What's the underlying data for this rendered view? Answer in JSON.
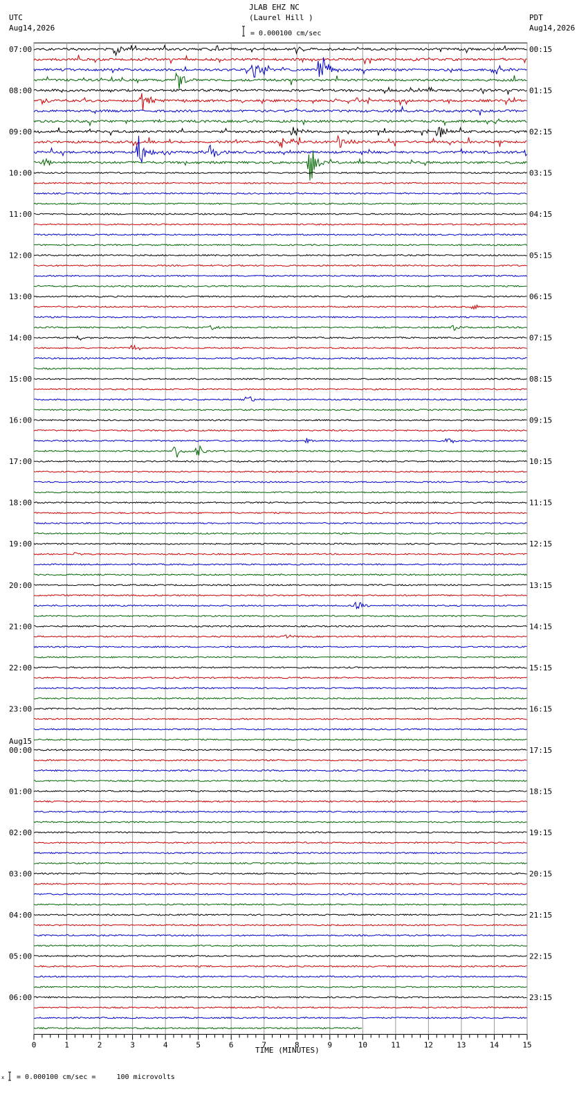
{
  "header": {
    "station": "JLAB EHZ NC",
    "location": "(Laurel Hill )",
    "scale_text": "= 0.000100 cm/sec",
    "left_tz": "UTC",
    "left_date": "Aug14,2026",
    "right_tz": "PDT",
    "right_date": "Aug14,2026"
  },
  "footer": {
    "scale_prefix": "x",
    "scale_text": "= 0.000100 cm/sec =     100 microvolts"
  },
  "chart_data": {
    "type": "line",
    "title": "JLAB EHZ NC (Laurel Hill )",
    "xlabel": "TIME (MINUTES)",
    "xlim": [
      0,
      15
    ],
    "x_ticks": [
      0,
      1,
      2,
      3,
      4,
      5,
      6,
      7,
      8,
      9,
      10,
      11,
      12,
      13,
      14,
      15
    ],
    "trace_colors": [
      "#000000",
      "#cc0000",
      "#0000cc",
      "#006600"
    ],
    "traces_per_hour": 4,
    "left_labels": [
      "07:00",
      "08:00",
      "09:00",
      "10:00",
      "11:00",
      "12:00",
      "13:00",
      "14:00",
      "15:00",
      "16:00",
      "17:00",
      "18:00",
      "19:00",
      "20:00",
      "21:00",
      "22:00",
      "23:00",
      "00:00",
      "01:00",
      "02:00",
      "03:00",
      "04:00",
      "05:00",
      "06:00"
    ],
    "date_change": {
      "hour_index": 17,
      "label": "Aug15"
    },
    "right_labels": [
      "00:15",
      "01:15",
      "02:15",
      "03:15",
      "04:15",
      "05:15",
      "06:15",
      "07:15",
      "08:15",
      "09:15",
      "10:15",
      "11:15",
      "12:15",
      "13:15",
      "14:15",
      "15:15",
      "16:15",
      "17:15",
      "18:15",
      "19:15",
      "20:15",
      "21:15",
      "22:15",
      "23:15"
    ],
    "events": [
      {
        "trace": 0,
        "minute": 2.5,
        "amplitude": 10
      },
      {
        "trace": 0,
        "minute": 8.0,
        "amplitude": 6
      },
      {
        "trace": 2,
        "minute": 6.7,
        "amplitude": 16
      },
      {
        "trace": 2,
        "minute": 8.7,
        "amplitude": 30
      },
      {
        "trace": 2,
        "minute": 14.0,
        "amplitude": 8
      },
      {
        "trace": 3,
        "minute": 4.4,
        "amplitude": 16
      },
      {
        "trace": 5,
        "minute": 3.3,
        "amplitude": 16
      },
      {
        "trace": 8,
        "minute": 7.9,
        "amplitude": 10
      },
      {
        "trace": 8,
        "minute": 12.3,
        "amplitude": 10
      },
      {
        "trace": 9,
        "minute": 7.5,
        "amplitude": 12
      },
      {
        "trace": 9,
        "minute": 9.3,
        "amplitude": 10
      },
      {
        "trace": 10,
        "minute": 3.2,
        "amplitude": 30
      },
      {
        "trace": 10,
        "minute": 5.4,
        "amplitude": 14
      },
      {
        "trace": 10,
        "minute": 15.0,
        "amplitude": 8
      },
      {
        "trace": 11,
        "minute": 0.3,
        "amplitude": 8
      },
      {
        "trace": 11,
        "minute": 8.4,
        "amplitude": 40
      },
      {
        "trace": 25,
        "minute": 13.4,
        "amplitude": 4
      },
      {
        "trace": 27,
        "minute": 5.4,
        "amplitude": 4
      },
      {
        "trace": 27,
        "minute": 12.8,
        "amplitude": 5
      },
      {
        "trace": 28,
        "minute": 1.4,
        "amplitude": 4
      },
      {
        "trace": 29,
        "minute": 3.0,
        "amplitude": 6
      },
      {
        "trace": 34,
        "minute": 6.5,
        "amplitude": 6
      },
      {
        "trace": 38,
        "minute": 8.3,
        "amplitude": 6
      },
      {
        "trace": 38,
        "minute": 12.6,
        "amplitude": 5
      },
      {
        "trace": 39,
        "minute": 4.3,
        "amplitude": 12
      },
      {
        "trace": 39,
        "minute": 5.0,
        "amplitude": 10
      },
      {
        "trace": 49,
        "minute": 1.3,
        "amplitude": 3
      },
      {
        "trace": 54,
        "minute": 9.8,
        "amplitude": 8
      },
      {
        "trace": 57,
        "minute": 7.7,
        "amplitude": 3
      }
    ]
  }
}
